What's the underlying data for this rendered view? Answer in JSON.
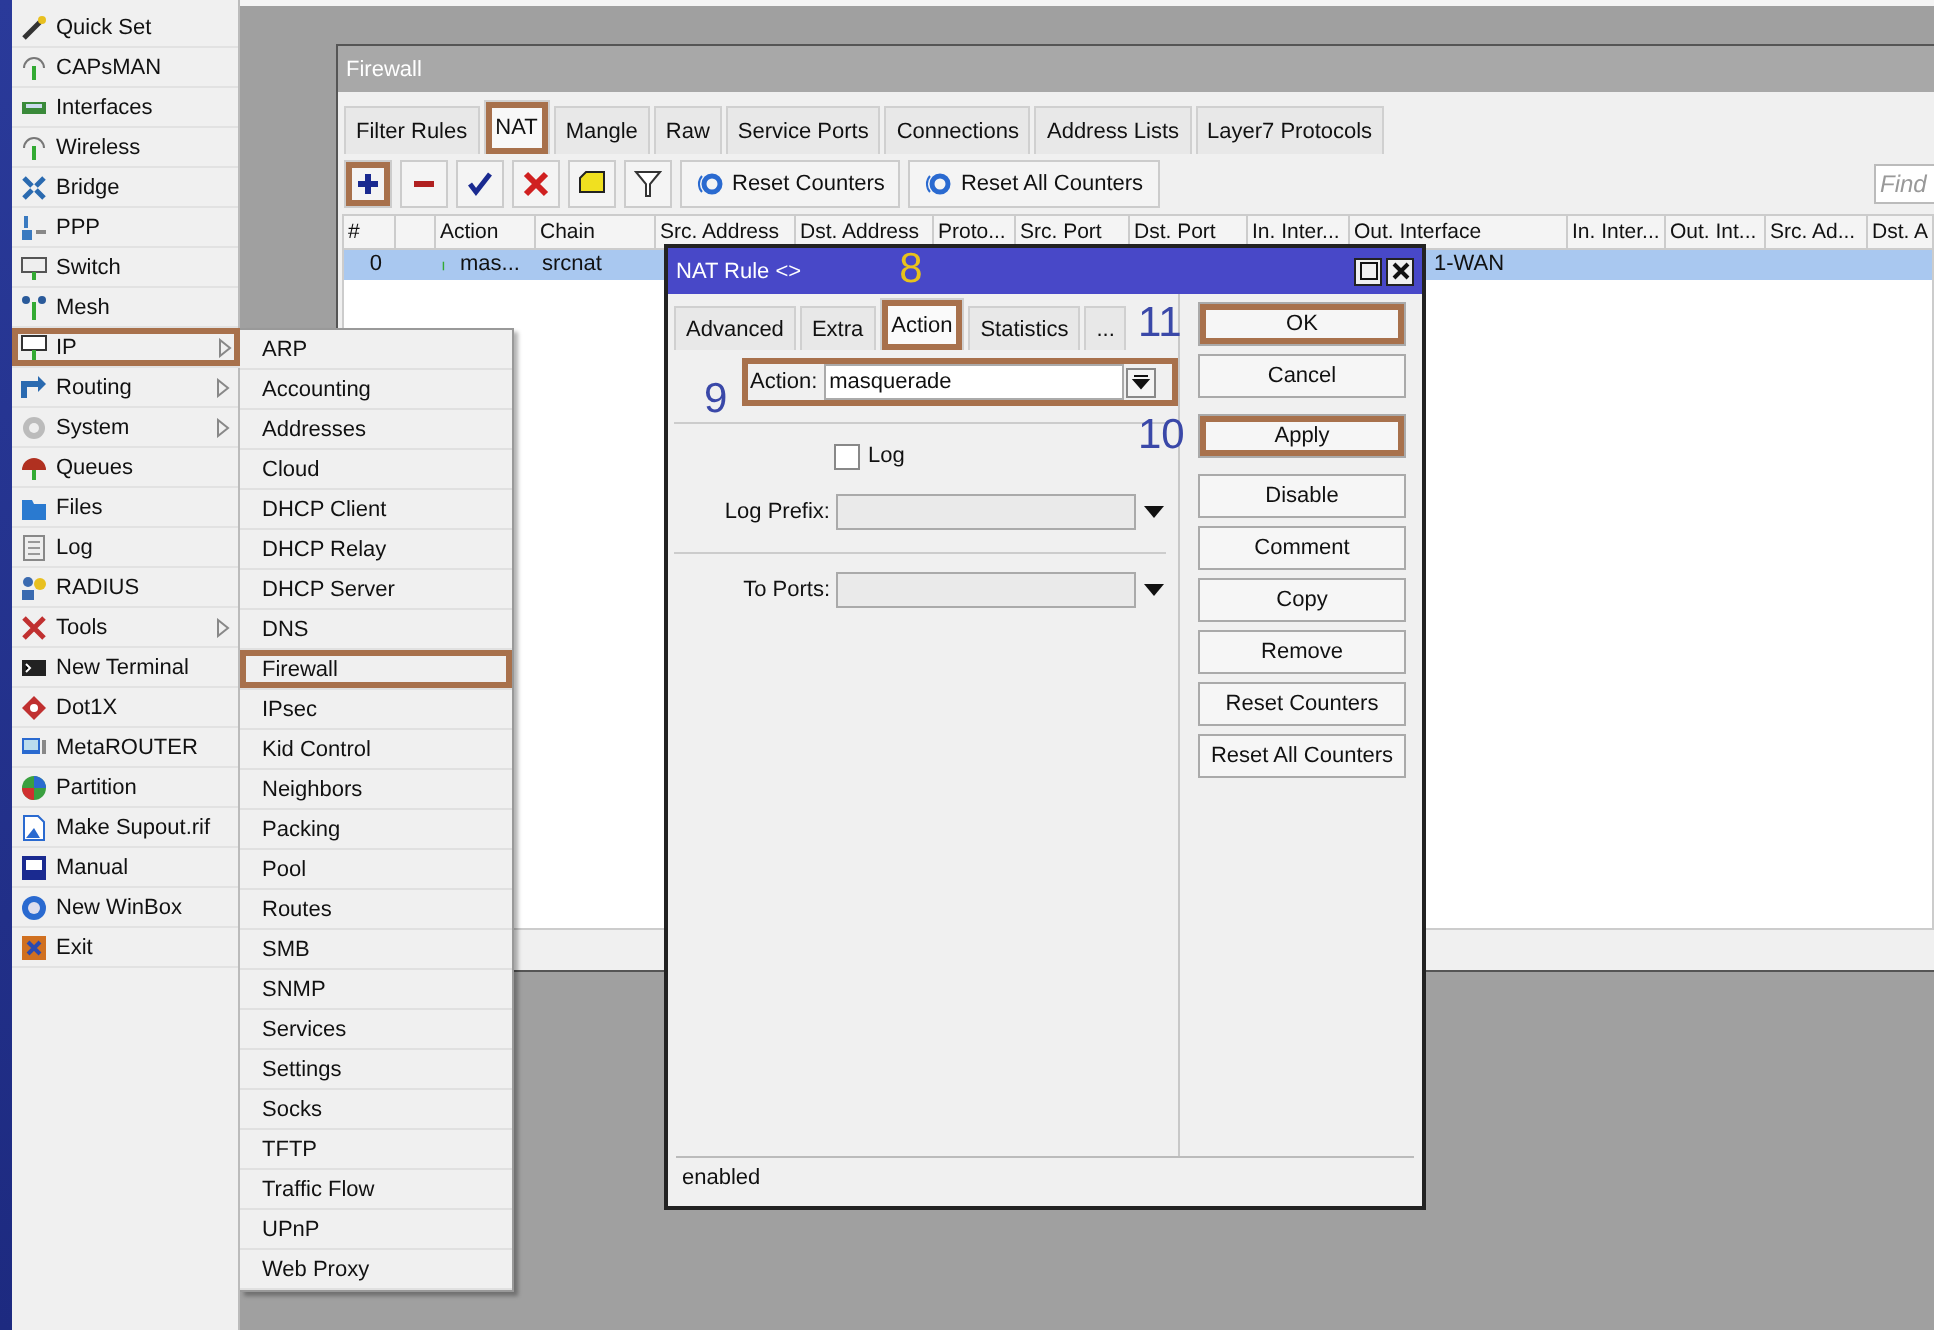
{
  "sidebar": {
    "items": [
      {
        "label": "Quick Set",
        "submenu": false,
        "highlighted": false
      },
      {
        "label": "CAPsMAN",
        "submenu": false,
        "highlighted": false
      },
      {
        "label": "Interfaces",
        "submenu": false,
        "highlighted": false
      },
      {
        "label": "Wireless",
        "submenu": false,
        "highlighted": false
      },
      {
        "label": "Bridge",
        "submenu": false,
        "highlighted": false
      },
      {
        "label": "PPP",
        "submenu": false,
        "highlighted": false
      },
      {
        "label": "Switch",
        "submenu": false,
        "highlighted": false
      },
      {
        "label": "Mesh",
        "submenu": false,
        "highlighted": false
      },
      {
        "label": "IP",
        "submenu": true,
        "highlighted": true
      },
      {
        "label": "Routing",
        "submenu": true,
        "highlighted": false
      },
      {
        "label": "System",
        "submenu": true,
        "highlighted": false
      },
      {
        "label": "Queues",
        "submenu": false,
        "highlighted": false
      },
      {
        "label": "Files",
        "submenu": false,
        "highlighted": false
      },
      {
        "label": "Log",
        "submenu": false,
        "highlighted": false
      },
      {
        "label": "RADIUS",
        "submenu": false,
        "highlighted": false
      },
      {
        "label": "Tools",
        "submenu": true,
        "highlighted": false
      },
      {
        "label": "New Terminal",
        "submenu": false,
        "highlighted": false
      },
      {
        "label": "Dot1X",
        "submenu": false,
        "highlighted": false
      },
      {
        "label": "MetaROUTER",
        "submenu": false,
        "highlighted": false
      },
      {
        "label": "Partition",
        "submenu": false,
        "highlighted": false
      },
      {
        "label": "Make Supout.rif",
        "submenu": false,
        "highlighted": false
      },
      {
        "label": "Manual",
        "submenu": false,
        "highlighted": false
      },
      {
        "label": "New WinBox",
        "submenu": false,
        "highlighted": false
      },
      {
        "label": "Exit",
        "submenu": false,
        "highlighted": false
      }
    ]
  },
  "submenu": {
    "items": [
      {
        "label": "ARP",
        "highlighted": false
      },
      {
        "label": "Accounting",
        "highlighted": false
      },
      {
        "label": "Addresses",
        "highlighted": false
      },
      {
        "label": "Cloud",
        "highlighted": false
      },
      {
        "label": "DHCP Client",
        "highlighted": false
      },
      {
        "label": "DHCP Relay",
        "highlighted": false
      },
      {
        "label": "DHCP Server",
        "highlighted": false
      },
      {
        "label": "DNS",
        "highlighted": false
      },
      {
        "label": "Firewall",
        "highlighted": true
      },
      {
        "label": "IPsec",
        "highlighted": false
      },
      {
        "label": "Kid Control",
        "highlighted": false
      },
      {
        "label": "Neighbors",
        "highlighted": false
      },
      {
        "label": "Packing",
        "highlighted": false
      },
      {
        "label": "Pool",
        "highlighted": false
      },
      {
        "label": "Routes",
        "highlighted": false
      },
      {
        "label": "SMB",
        "highlighted": false
      },
      {
        "label": "SNMP",
        "highlighted": false
      },
      {
        "label": "Services",
        "highlighted": false
      },
      {
        "label": "Settings",
        "highlighted": false
      },
      {
        "label": "Socks",
        "highlighted": false
      },
      {
        "label": "TFTP",
        "highlighted": false
      },
      {
        "label": "Traffic Flow",
        "highlighted": false
      },
      {
        "label": "UPnP",
        "highlighted": false
      },
      {
        "label": "Web Proxy",
        "highlighted": false
      }
    ]
  },
  "firewall": {
    "title": "Firewall",
    "tabs": [
      {
        "label": "Filter Rules",
        "selected": false,
        "highlighted": false
      },
      {
        "label": "NAT",
        "selected": true,
        "highlighted": true
      },
      {
        "label": "Mangle",
        "selected": false,
        "highlighted": false
      },
      {
        "label": "Raw",
        "selected": false,
        "highlighted": false
      },
      {
        "label": "Service Ports",
        "selected": false,
        "highlighted": false
      },
      {
        "label": "Connections",
        "selected": false,
        "highlighted": false
      },
      {
        "label": "Address Lists",
        "selected": false,
        "highlighted": false
      },
      {
        "label": "Layer7 Protocols",
        "selected": false,
        "highlighted": false
      }
    ],
    "icon_buttons": [
      {
        "highlighted": true
      },
      {
        "highlighted": false
      },
      {
        "highlighted": false
      },
      {
        "highlighted": false
      },
      {
        "highlighted": false
      },
      {
        "highlighted": false
      }
    ],
    "buttons": [
      "Reset Counters",
      "Reset All Counters"
    ],
    "search": {
      "placeholder": "Find"
    },
    "table": {
      "columns": [
        "#",
        "Action",
        "Chain",
        "Src. Address",
        "Dst. Address",
        "Proto...",
        "Src. Port",
        "Dst. Port",
        "In. Inter...",
        "Out. Interface",
        "In. Inter...",
        "Out. Int...",
        "Src. Ad...",
        "Dst. A"
      ],
      "rows": [
        {
          "selected": true,
          "number": "0",
          "action": "mas...",
          "chain": "srcnat",
          "out_interface": "1-WAN"
        }
      ]
    }
  },
  "dialog": {
    "title": "NAT Rule <>",
    "tabs": [
      {
        "label": "Advanced",
        "selected": false
      },
      {
        "label": "Extra",
        "selected": false
      },
      {
        "label": "Action",
        "selected": true,
        "step": "8"
      },
      {
        "label": "Statistics",
        "selected": false
      },
      {
        "label": "...",
        "selected": false
      }
    ],
    "action": {
      "label": "Action:",
      "value": "masquerade",
      "step": "9"
    },
    "log": {
      "label": "Log",
      "checked": false
    },
    "log_prefix": {
      "label": "Log Prefix:"
    },
    "to_ports": {
      "label": "To Ports:"
    },
    "buttons": [
      {
        "label": "OK",
        "highlighted": true,
        "step": "11"
      },
      {
        "label": "Cancel",
        "highlighted": false
      },
      {
        "label": "Apply",
        "highlighted": true,
        "step": "10"
      },
      {
        "label": "Disable",
        "highlighted": false
      },
      {
        "label": "Comment",
        "highlighted": false
      },
      {
        "label": "Copy",
        "highlighted": false
      },
      {
        "label": "Remove",
        "highlighted": false
      },
      {
        "label": "Reset Counters",
        "highlighted": false
      },
      {
        "label": "Reset All Counters",
        "highlighted": false
      }
    ],
    "status": "enabled"
  }
}
